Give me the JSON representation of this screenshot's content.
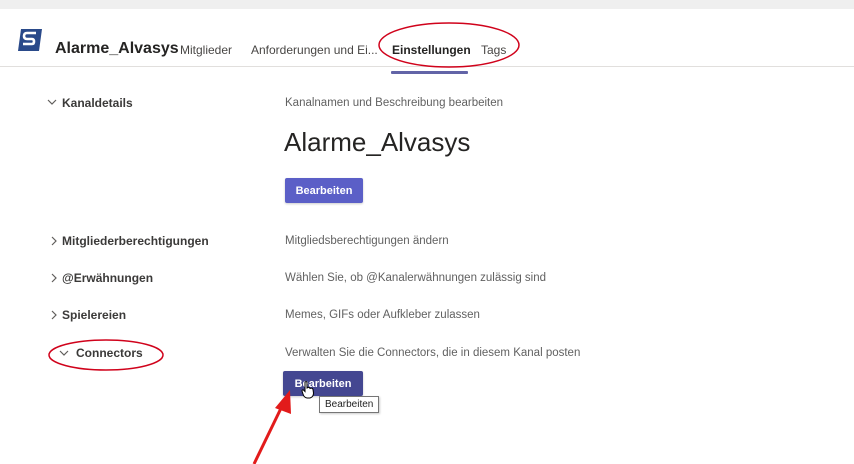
{
  "header": {
    "app_title": "Alarme_Alvasys",
    "tabs": [
      {
        "label": "Mitglieder"
      },
      {
        "label": "Anforderungen und Ei..."
      },
      {
        "label": "Einstellungen",
        "active": true
      },
      {
        "label": "Tags"
      }
    ],
    "accent_color": "#6264a7"
  },
  "settings": {
    "kanaldetails": {
      "label": "Kanaldetails",
      "expanded": true,
      "description": "Kanalnamen und Beschreibung bearbeiten",
      "channel_name": "Alarme_Alvasys",
      "button_label": "Bearbeiten"
    },
    "mitgliederberechtigungen": {
      "label": "Mitgliederberechtigungen",
      "expanded": false,
      "description": "Mitgliedsberechtigungen ändern"
    },
    "erwaehnungen": {
      "label": "@Erwähnungen",
      "expanded": false,
      "description": "Wählen Sie, ob @Kanalerwähnungen zulässig sind"
    },
    "spielereien": {
      "label": "Spielereien",
      "expanded": false,
      "description": "Memes, GIFs oder Aufkleber zulassen"
    },
    "connectors": {
      "label": "Connectors",
      "expanded": true,
      "description": "Verwalten Sie die Connectors, die in diesem Kanal posten",
      "button_label": "Bearbeiten",
      "tooltip": "Bearbeiten"
    }
  },
  "icons": {
    "expanded": "chevron-down-icon",
    "collapsed": "chevron-right-icon",
    "cursor": "hand-pointer-icon"
  },
  "annotation_colors": {
    "ellipse": "#d0021b",
    "arrow": "#e21b1b"
  }
}
